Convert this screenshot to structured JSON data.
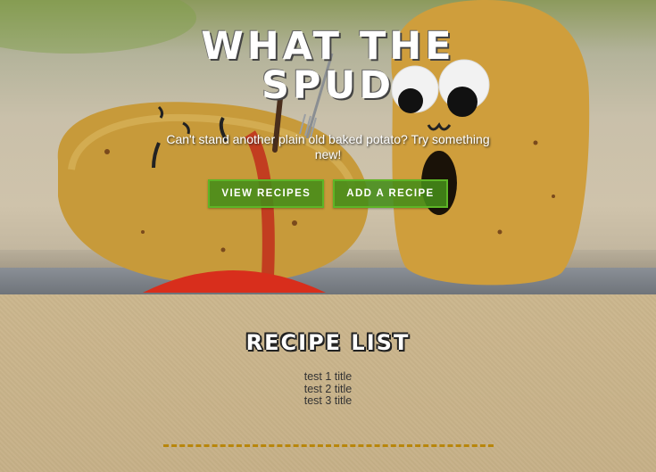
{
  "hero": {
    "title": "What The Spud",
    "tagline": "Can't stand another plain old baked potato? Try something new!",
    "buttons": {
      "view_recipes": "View Recipes",
      "add_recipe": "Add a Recipe"
    }
  },
  "recipes": {
    "heading": "Recipe List",
    "items": [
      "test 1 title",
      "test 2 title",
      "test 3 title"
    ]
  },
  "colors": {
    "button_green": "#448c18",
    "divider_gold": "#b8860b",
    "section_background": "#c8b48a"
  }
}
